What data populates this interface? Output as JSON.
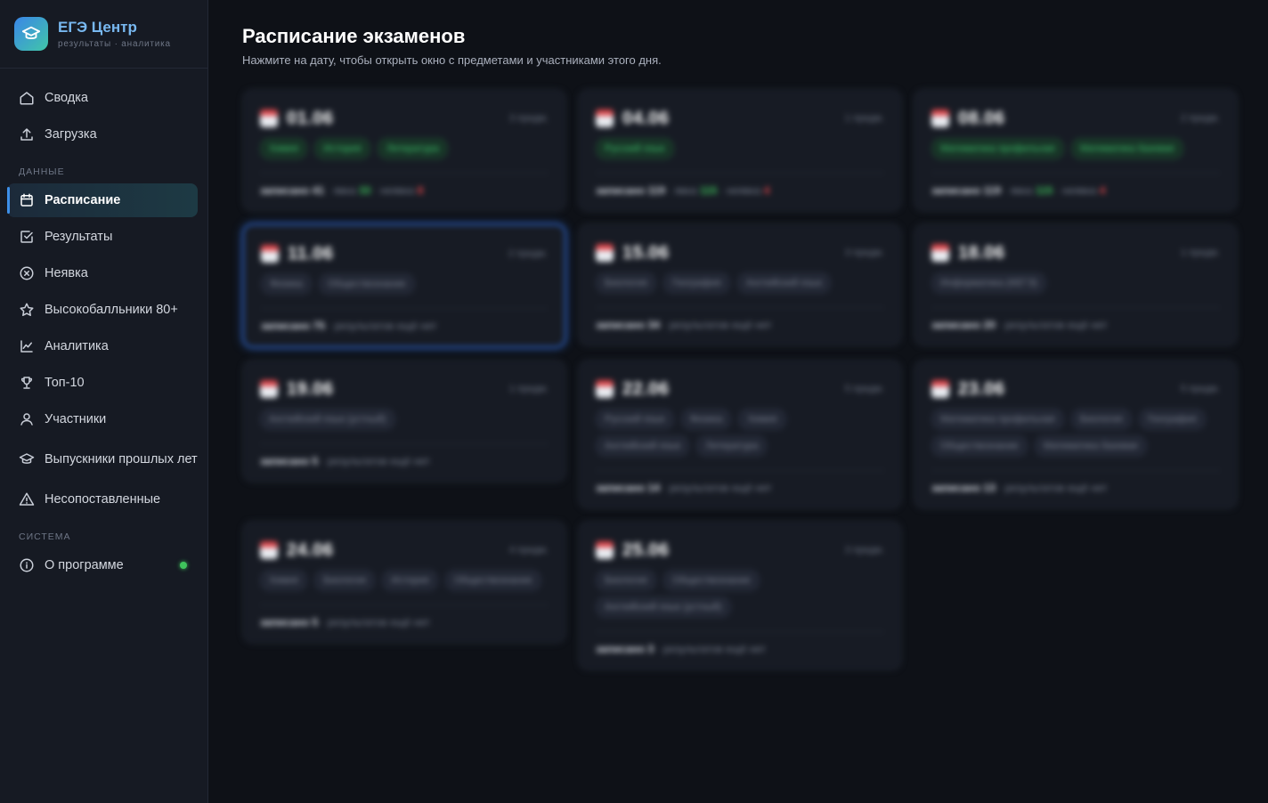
{
  "brand": {
    "title": "ЕГЭ Центр",
    "subtitle": "результаты · аналитика"
  },
  "nav": {
    "items_top": [
      {
        "label": "Сводка",
        "icon": "home-icon"
      },
      {
        "label": "Загрузка",
        "icon": "upload-icon"
      }
    ],
    "section_data": "ДАННЫЕ",
    "items_data": [
      {
        "label": "Расписание",
        "icon": "calendar-icon",
        "active": true
      },
      {
        "label": "Результаты",
        "icon": "checkbox-icon"
      },
      {
        "label": "Неявка",
        "icon": "x-circle-icon"
      },
      {
        "label": "Высокобалльники 80+",
        "icon": "star-icon"
      },
      {
        "label": "Аналитика",
        "icon": "chart-icon"
      },
      {
        "label": "Топ-10",
        "icon": "trophy-icon"
      },
      {
        "label": "Участники",
        "icon": "user-icon"
      },
      {
        "label": "Выпускники прошлых лет",
        "icon": "graduation-cap-icon"
      },
      {
        "label": "Несопоставленные",
        "icon": "warning-icon"
      }
    ],
    "section_system": "СИСТЕМА",
    "items_system": [
      {
        "label": "О программе",
        "icon": "info-icon",
        "status": "online"
      }
    ]
  },
  "page": {
    "title": "Расписание экзаменов",
    "subtitle": "Нажмите на дату, чтобы открыть окно с предметами и участниками этого дня."
  },
  "colors": {
    "accent": "#3d8fe8",
    "success": "#3fc45c",
    "danger": "#e5484d"
  },
  "cards": [
    {
      "date": "01.06",
      "count": "3 предм.",
      "tags": [
        "Химия",
        "История",
        "Литература"
      ],
      "tags_green": true,
      "footer": {
        "enrolled_label": "записано",
        "enrolled": "41",
        "appeared_label": "явка",
        "appeared": "33",
        "absent_label": "неявка",
        "absent": "8"
      }
    },
    {
      "date": "04.06",
      "count": "1 предм.",
      "tags": [
        "Русский язык"
      ],
      "tags_green": true,
      "footer": {
        "enrolled_label": "записано",
        "enrolled": "119",
        "appeared_label": "явка",
        "appeared": "115",
        "absent_label": "неявка",
        "absent": "4"
      }
    },
    {
      "date": "08.06",
      "count": "2 предм.",
      "tags": [
        "Математика профильная",
        "Математика базовая"
      ],
      "tags_green": true,
      "footer": {
        "enrolled_label": "записано",
        "enrolled": "119",
        "appeared_label": "явка",
        "appeared": "115",
        "absent_label": "неявка",
        "absent": "4"
      }
    },
    {
      "date": "11.06",
      "count": "2 предм.",
      "tags": [
        "Физика",
        "Обществознание"
      ],
      "selected": true,
      "footer": {
        "enrolled_label": "записано",
        "enrolled": "75",
        "note": "результатов ещё нет"
      }
    },
    {
      "date": "15.06",
      "count": "3 предм.",
      "tags": [
        "Биология",
        "География",
        "Английский язык"
      ],
      "footer": {
        "enrolled_label": "записано",
        "enrolled": "34",
        "note": "результатов ещё нет"
      }
    },
    {
      "date": "18.06",
      "count": "1 предм.",
      "tags": [
        "Информатика (КЕГЭ)"
      ],
      "footer": {
        "enrolled_label": "записано",
        "enrolled": "20",
        "note": "результатов ещё нет"
      }
    },
    {
      "date": "19.06",
      "count": "1 предм.",
      "tags": [
        "Английский язык (устный)"
      ],
      "footer": {
        "enrolled_label": "записано",
        "enrolled": "5",
        "note": "результатов ещё нет"
      }
    },
    {
      "date": "22.06",
      "count": "5 предм.",
      "tags": [
        "Русский язык",
        "Физика",
        "Химия",
        "Английский язык",
        "Литература"
      ],
      "footer": {
        "enrolled_label": "записано",
        "enrolled": "14",
        "note": "результатов ещё нет"
      }
    },
    {
      "date": "23.06",
      "count": "5 предм.",
      "tags": [
        "Математика профильная",
        "Биология",
        "География",
        "Обществознание",
        "Математика базовая"
      ],
      "footer": {
        "enrolled_label": "записано",
        "enrolled": "13",
        "note": "результатов ещё нет"
      }
    },
    {
      "date": "24.06",
      "count": "4 предм.",
      "tags": [
        "Химия",
        "Биология",
        "История",
        "Обществознание"
      ],
      "footer": {
        "enrolled_label": "записано",
        "enrolled": "5",
        "note": "результатов ещё нет"
      }
    },
    {
      "date": "25.06",
      "count": "3 предм.",
      "tags": [
        "Биология",
        "Обществознание",
        "Английский язык (устный)"
      ],
      "footer": {
        "enrolled_label": "записано",
        "enrolled": "3",
        "note": "результатов ещё нет"
      }
    }
  ]
}
